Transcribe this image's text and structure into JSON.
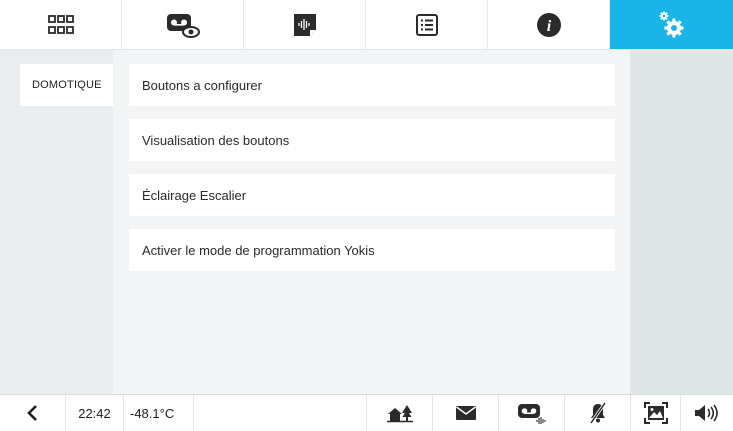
{
  "colors": {
    "accent": "#19b4e8",
    "icon": "#2b2b2b"
  },
  "top_tabs": [
    {
      "icon": "apps-grid-icon",
      "active": false
    },
    {
      "icon": "video-message-view-icon",
      "active": false
    },
    {
      "icon": "audio-message-icon",
      "active": false
    },
    {
      "icon": "list-icon",
      "active": false
    },
    {
      "icon": "info-icon",
      "active": false
    },
    {
      "icon": "settings-gears-icon",
      "active": true
    }
  ],
  "sidebar": {
    "items": [
      {
        "label": "DOMOTIQUE"
      }
    ]
  },
  "main": {
    "rows": [
      {
        "label": "Boutons a configurer"
      },
      {
        "label": "Visualisation des boutons"
      },
      {
        "label": "Éclairage Escalier"
      },
      {
        "label": "Activer le mode de programmation Yokis"
      }
    ]
  },
  "status_bar": {
    "time": "22:42",
    "temperature": "-48.1°C",
    "icons": [
      "back-arrow-icon",
      "home-icon",
      "mail-icon",
      "video-message-icon",
      "bell-muted-icon",
      "screen-capture-icon",
      "volume-icon"
    ]
  }
}
